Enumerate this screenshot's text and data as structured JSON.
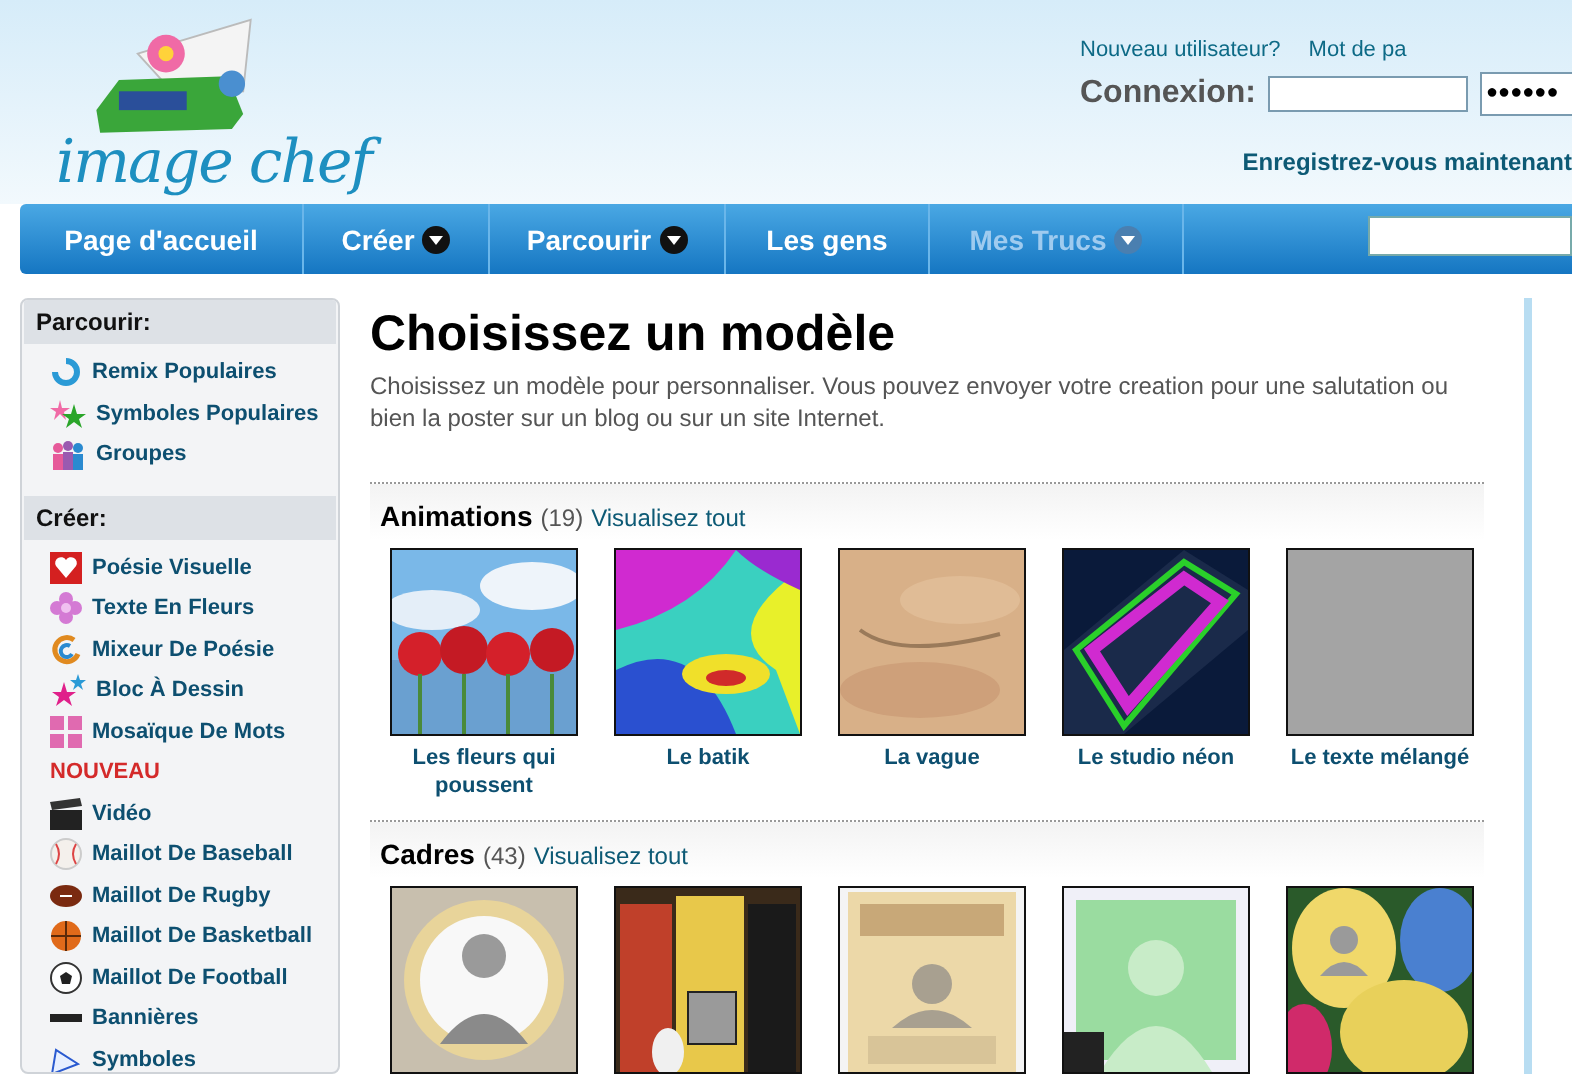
{
  "header": {
    "logo": "image chef",
    "new_user": "Nouveau utilisateur?",
    "password_label": "Mot de pa",
    "login_label": "Connexion:",
    "password_value": "●●●●●●",
    "register": "Enregistrez-vous maintenant"
  },
  "nav": [
    {
      "label": "Page d'accueil",
      "menu": false,
      "disabled": false
    },
    {
      "label": "Créer",
      "menu": true,
      "disabled": false
    },
    {
      "label": "Parcourir",
      "menu": true,
      "disabled": false
    },
    {
      "label": "Les gens",
      "menu": false,
      "disabled": false
    },
    {
      "label": "Mes Trucs",
      "menu": true,
      "disabled": true
    }
  ],
  "sidebar": [
    {
      "title": "Parcourir:",
      "items": [
        {
          "kind": "link",
          "label": "Remix Populaires"
        },
        {
          "kind": "link",
          "label": "Symboles Populaires"
        },
        {
          "kind": "link",
          "label": "Groupes"
        }
      ]
    },
    {
      "title": "Créer:",
      "items": [
        {
          "kind": "link",
          "label": "Poésie Visuelle"
        },
        {
          "kind": "link",
          "label": "Texte En Fleurs"
        },
        {
          "kind": "link",
          "label": "Mixeur De Poésie"
        },
        {
          "kind": "link",
          "label": "Bloc À Dessin"
        },
        {
          "kind": "link",
          "label": "Mosaïque De Mots"
        },
        {
          "kind": "badge",
          "label": "NOUVEAU"
        },
        {
          "kind": "link",
          "label": "Vidéo"
        },
        {
          "kind": "link",
          "label": "Maillot De Baseball"
        },
        {
          "kind": "link",
          "label": "Maillot De Rugby"
        },
        {
          "kind": "link",
          "label": "Maillot De Basketball"
        },
        {
          "kind": "link",
          "label": "Maillot De Football"
        },
        {
          "kind": "link",
          "label": "Bannières"
        },
        {
          "kind": "link",
          "label": "Symboles"
        }
      ]
    }
  ],
  "main": {
    "title": "Choisissez un modèle",
    "intro": "Choisissez un modèle pour personnaliser. Vous pouvez envoyer votre creation pour une salutation ou bien la poster sur un blog ou sur un site Internet.",
    "sections": [
      {
        "title": "Animations",
        "count": "(19)",
        "link": "Visualisez tout",
        "items": [
          {
            "label": "Les fleurs qui poussent"
          },
          {
            "label": "Le batik"
          },
          {
            "label": "La vague"
          },
          {
            "label": "Le studio néon"
          },
          {
            "label": "Le texte mélangé"
          }
        ]
      },
      {
        "title": "Cadres",
        "count": "(43)",
        "link": "Visualisez tout"
      }
    ]
  }
}
